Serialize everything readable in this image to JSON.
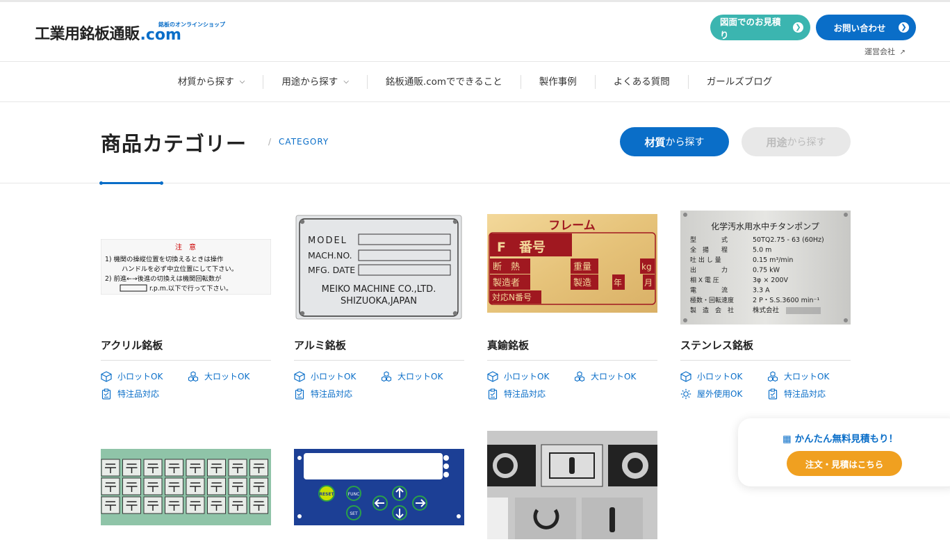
{
  "header": {
    "logo_main": "工業用銘板通販",
    "logo_com": ".com",
    "logo_tag": "銘板のオンラインショップ",
    "btn_estimate": "図面でのお見積り",
    "btn_contact": "お問い合わせ",
    "company_link": "運営会社"
  },
  "nav": {
    "items": [
      "材質から探す",
      "用途から探す",
      "銘板通販.comでできること",
      "製作事例",
      "よくある質問",
      "ガールズブログ"
    ]
  },
  "section": {
    "title": "商品カテゴリー",
    "subtitle": "CATEGORY",
    "slash": "/",
    "btn_material_strong": "材質",
    "btn_material_rest": "から探す",
    "btn_use_strong": "用途",
    "btn_use_rest": "から探す"
  },
  "products": [
    {
      "name": "アクリル銘板",
      "features": [
        "小ロットOK",
        "大ロットOK",
        "特注品対応"
      ]
    },
    {
      "name": "アルミ銘板",
      "features": [
        "小ロットOK",
        "大ロットOK",
        "特注品対応"
      ]
    },
    {
      "name": "真鍮銘板",
      "features": [
        "小ロットOK",
        "大ロットOK",
        "特注品対応"
      ]
    },
    {
      "name": "ステンレス銘板",
      "features": [
        "小ロットOK",
        "大ロットOK",
        "屋外使用OK",
        "特注品対応"
      ]
    }
  ],
  "plates": {
    "acrylic": {
      "title": "注　意",
      "line1": "1) 機関の操縦位置を切換えるときは操作",
      "line2": "ハンドルを必ず中立位置にして下さい。",
      "line3": "2) 前進←→後進の切換えは機関回転数が",
      "line4": "r.p.m.以下で行って下さい。"
    },
    "aluminum": {
      "model": "MODEL",
      "mach": "MACH.NO.",
      "mfg": "MFG. DATE",
      "company": "MEIKO MACHINE CO.,LTD.",
      "place": "SHIZUOKA,JAPAN"
    },
    "brass": {
      "title": "フレーム",
      "f_label": "F　番号",
      "r1a": "断　熱",
      "r1b": "重量",
      "r1c": "kg",
      "r2a": "製造者",
      "r2b": "製造",
      "r2c": "年",
      "r2d": "月",
      "r3a": "対応N番号"
    },
    "stainless": {
      "title": "化学汚水用水中チタンポンプ",
      "rows": [
        [
          "型　　　　式",
          "50TQ2.75 - 63 (60Hz)"
        ],
        [
          "全　揚　　程",
          "5.0 m"
        ],
        [
          "吐 出 し 量",
          "0.15 m³/min"
        ],
        [
          "出　　　　力",
          "0.75 kW"
        ],
        [
          "相 X 電 圧",
          "3φ × 200V"
        ],
        [
          "電　　　　流",
          "3.3 A"
        ],
        [
          "極数・回転速度",
          "2 P・S.S.3600 min⁻¹"
        ],
        [
          "製　造　会　社",
          "株式会社"
        ]
      ]
    },
    "control": {
      "reset": "RESET",
      "func": "FUNC",
      "set": "SET"
    }
  },
  "float": {
    "title": "かんたん無料見積もり！",
    "button": "注文・見積はこちら"
  },
  "colors": {
    "primary": "#0a6ec8",
    "teal": "#3bb5b0",
    "orange": "#f0a020"
  }
}
